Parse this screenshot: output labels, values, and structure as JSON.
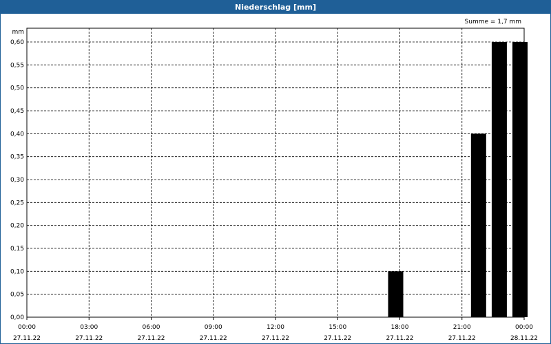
{
  "chart_title": "Niederschlag [mm]",
  "colors": {
    "title_bar": "#1f5f97",
    "bar": "#000000",
    "grid": "#000000"
  },
  "chart_data": {
    "type": "bar",
    "unit": "mm",
    "annotation": "Summe = 1,7 mm",
    "grid": true,
    "grid_style": "dashed",
    "ylim": [
      0,
      0.6
    ],
    "xlim": [
      "27.11.22 00:00",
      "28.11.22 00:00"
    ],
    "y_ticks": [
      {
        "value": 0.0,
        "label": "0,00"
      },
      {
        "value": 0.05,
        "label": "0,05"
      },
      {
        "value": 0.1,
        "label": "0,10"
      },
      {
        "value": 0.15,
        "label": "0,15"
      },
      {
        "value": 0.2,
        "label": "0,20"
      },
      {
        "value": 0.25,
        "label": "0,25"
      },
      {
        "value": 0.3,
        "label": "0,30"
      },
      {
        "value": 0.35,
        "label": "0,35"
      },
      {
        "value": 0.4,
        "label": "0,40"
      },
      {
        "value": 0.45,
        "label": "0,45"
      },
      {
        "value": 0.5,
        "label": "0,50"
      },
      {
        "value": 0.55,
        "label": "0,55"
      },
      {
        "value": 0.6,
        "label": "0,60"
      }
    ],
    "x_ticks": [
      {
        "hour": 0,
        "time": "00:00",
        "date": "27.11.22"
      },
      {
        "hour": 3,
        "time": "03:00",
        "date": "27.11.22"
      },
      {
        "hour": 6,
        "time": "06:00",
        "date": "27.11.22"
      },
      {
        "hour": 9,
        "time": "09:00",
        "date": "27.11.22"
      },
      {
        "hour": 12,
        "time": "12:00",
        "date": "27.11.22"
      },
      {
        "hour": 15,
        "time": "15:00",
        "date": "27.11.22"
      },
      {
        "hour": 18,
        "time": "18:00",
        "date": "27.11.22"
      },
      {
        "hour": 21,
        "time": "21:00",
        "date": "27.11.22"
      },
      {
        "hour": 24,
        "time": "00:00",
        "date": "28.11.22"
      }
    ],
    "bars": [
      {
        "x": "27.11.22 18:00",
        "value": 0.1
      },
      {
        "x": "27.11.22 22:00",
        "value": 0.4
      },
      {
        "x": "27.11.22 23:00",
        "value": 0.6
      },
      {
        "x": "28.11.22 00:00",
        "value": 0.6
      }
    ]
  }
}
